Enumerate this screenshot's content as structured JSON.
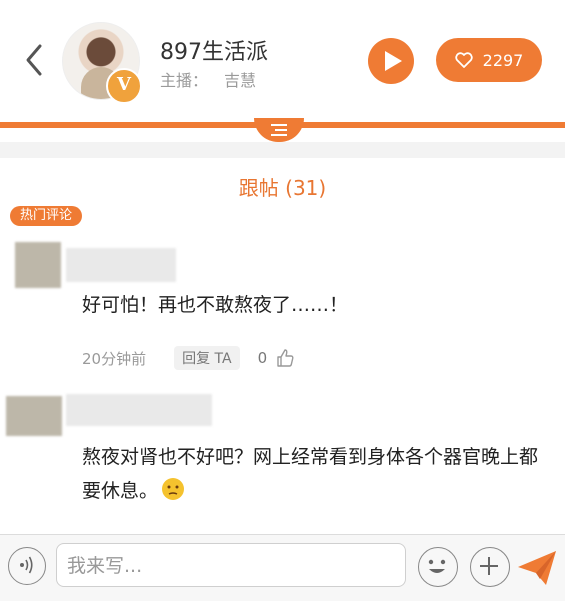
{
  "header": {
    "title": "897生活派",
    "host_label": "主播：",
    "host_name": "吉慧",
    "like_count": "2297",
    "badge_letter": "V"
  },
  "thread": {
    "section_title": "跟帖 (31)",
    "hot_tag": "热门评论"
  },
  "comments": [
    {
      "text": "好可怕！再也不敢熬夜了……！",
      "time": "20分钟前",
      "reply_label": "回复 TA",
      "likes": "0"
    },
    {
      "text": "熬夜对肾也不好吧？网上经常看到身体各个器官晚上都要休息。",
      "time": "",
      "reply_label": "",
      "likes": ""
    }
  ],
  "composer": {
    "placeholder": "我来写..."
  },
  "colors": {
    "accent": "#ef7b34",
    "section_title": "#e87632",
    "badge": "#f0a23c"
  },
  "icons": {
    "back": "chevron-left-icon",
    "play": "play-icon",
    "like": "heart-icon",
    "voice": "voice-icon",
    "emoji": "smiley-icon",
    "plus": "plus-icon",
    "send": "send-icon",
    "thumb": "thumb-up-icon"
  }
}
